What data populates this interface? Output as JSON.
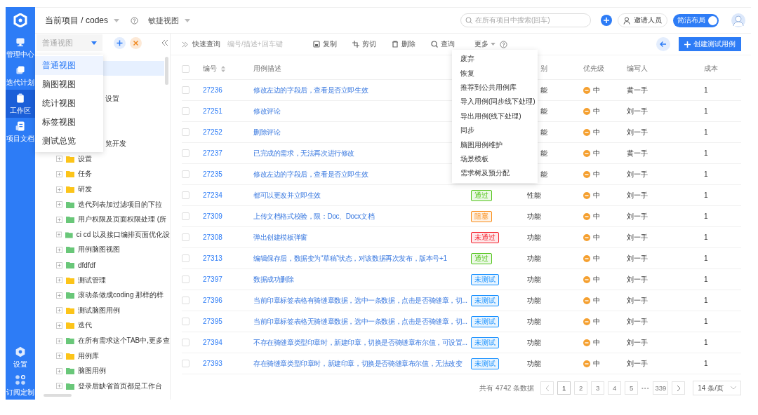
{
  "sidebar": {
    "items": [
      {
        "label": "管理中心",
        "selected": false
      },
      {
        "label": "迭代计划",
        "selected": false
      },
      {
        "label": "工作区",
        "selected": true
      },
      {
        "label": "项目文档",
        "selected": false
      }
    ],
    "bottom_items": [
      {
        "label": "设置"
      },
      {
        "label": "订阅定制"
      }
    ]
  },
  "topbar": {
    "project": "当前项目 / codes",
    "view": "敏捷视图",
    "search_placeholder": "在所有项目中搜索(回车)",
    "invite": "邀请人员",
    "layout_toggle": {
      "label": "简洁布局",
      "on": true
    }
  },
  "view_panel": {
    "select": {
      "value": "普通视图"
    },
    "options": [
      {
        "label": "普通视图",
        "selected": true
      },
      {
        "label": "脑图视图",
        "selected": false
      },
      {
        "label": "统计视图",
        "selected": false
      },
      {
        "label": "标签视图",
        "selected": false
      },
      {
        "label": "测试总览",
        "selected": false
      }
    ],
    "tree": [
      {
        "kind": "covered",
        "selected": true
      },
      {
        "kind": "covered",
        "selected": false
      },
      {
        "kind": "covered",
        "selected": false,
        "text": "设置"
      },
      {
        "kind": "covered",
        "selected": false
      },
      {
        "kind": "covered",
        "selected": false
      },
      {
        "kind": "covered",
        "selected": false,
        "text": "览开发"
      },
      {
        "kind": "folder",
        "text": "设置",
        "color": "#fcc419"
      },
      {
        "kind": "folder",
        "text": "任务",
        "color": "#fcc419"
      },
      {
        "kind": "folder",
        "text": "研发",
        "color": "#fcc419"
      },
      {
        "kind": "folder",
        "text": "迭代列表加过滤项目的下拉",
        "color": "#69c779"
      },
      {
        "kind": "folder",
        "text": "用户权限及页面权限处理 (所",
        "color": "#69c779"
      },
      {
        "kind": "folder",
        "text": "ci cd 以及接口编排页面优化设",
        "color": "#69c779"
      },
      {
        "kind": "folder",
        "text": " 用例脑图视图",
        "color": "#69c779"
      },
      {
        "kind": "folder",
        "text": "dfdfdf",
        "color": "#69c779"
      },
      {
        "kind": "folder",
        "text": "测试管理",
        "color": "#fcc419"
      },
      {
        "kind": "folder",
        "text": "滚动条做成coding 那样的样",
        "color": "#69c779"
      },
      {
        "kind": "folder",
        "text": "测试脑图用例",
        "color": "#fcc419"
      },
      {
        "kind": "folder",
        "text": "迭代",
        "color": "#fcc419"
      },
      {
        "kind": "folder",
        "text": "在所有需求这个TAB中,更多查",
        "color": "#69c779"
      },
      {
        "kind": "folder",
        "text": "用例库",
        "color": "#fcc419"
      },
      {
        "kind": "folder",
        "text": "脑图用例",
        "color": "#69c779"
      },
      {
        "kind": "folder",
        "text": "登录后缺省首页都是工作台",
        "color": "#69c779"
      }
    ]
  },
  "toolbar": {
    "quick_query": "快速查询",
    "query_placeholder": "编号/描述+回车键",
    "actions": [
      "复制",
      "剪切",
      "删除",
      "查询"
    ],
    "more": "更多",
    "create": "创建测试用例"
  },
  "more_menu": [
    "废弃",
    "恢复",
    "推荐到公共用例库",
    "导入用例(同步线下处理)",
    "导出用例(线下处理)",
    "同步",
    "脑图用例维护",
    "场景模板",
    "需求树及预分配"
  ],
  "table": {
    "all_checked": false,
    "columns": {
      "id": "编号",
      "description": "用例描述",
      "category": "别",
      "priority": "优先级",
      "author": "编写人",
      "cost": "成本"
    },
    "rows": [
      {
        "checked": false,
        "id": "27236",
        "description": "修改左边的字段后，查看是否立即生效",
        "covered": true,
        "category": "能",
        "priority": "中",
        "author": "黄一手",
        "cost": "1"
      },
      {
        "checked": false,
        "id": "27251",
        "description": "修改评论",
        "covered": true,
        "category": "能",
        "priority": "中",
        "author": "刘一手",
        "cost": "1"
      },
      {
        "checked": false,
        "id": "27252",
        "description": "删除评论",
        "covered": true,
        "category": "能",
        "priority": "中",
        "author": "刘一手",
        "cost": "1"
      },
      {
        "checked": false,
        "id": "27237",
        "description": "已完成的需求，无法再次进行修改",
        "covered": true,
        "category": "能",
        "priority": "中",
        "author": "黄一手",
        "cost": "1"
      },
      {
        "checked": false,
        "id": "27235",
        "description": "修改左边的字段后，查看是否立即生效",
        "covered": true,
        "category": "能",
        "priority": "中",
        "author": "刘一手",
        "cost": "1"
      },
      {
        "checked": false,
        "id": "27234",
        "description": "都可以更改并立即生效",
        "covered": false,
        "status": {
          "text": "通过",
          "color": "#52c41a"
        },
        "category": "性能",
        "priority": "中",
        "author": "刘一手",
        "cost": "1"
      },
      {
        "checked": false,
        "id": "27309",
        "description": "上传文档格式校验，限：Doc、Docx文档",
        "covered": false,
        "status": {
          "text": "阻塞",
          "color": "#fa8c16"
        },
        "category": "功能",
        "priority": "中",
        "author": "刘一手",
        "cost": "1"
      },
      {
        "checked": false,
        "id": "27308",
        "description": "弹出创建模板弹窗",
        "covered": false,
        "status": {
          "text": "未通过",
          "color": "#f5222d"
        },
        "category": "功能",
        "priority": "中",
        "author": "刘一手",
        "cost": "1"
      },
      {
        "checked": false,
        "id": "27313",
        "description": "编辑保存后，数据变为“草稿”状态，对该数据再次发布，版本号+1",
        "covered": false,
        "status": {
          "text": "通过",
          "color": "#52c41a"
        },
        "category": "功能",
        "priority": "中",
        "author": "刘一手",
        "cost": "1"
      },
      {
        "checked": false,
        "id": "27397",
        "description": "数据成功删除",
        "covered": false,
        "status": {
          "text": "未测试",
          "color": "#1890ff"
        },
        "category": "功能",
        "priority": "中",
        "author": "刘一手",
        "cost": "1"
      },
      {
        "checked": false,
        "id": "27396",
        "description": "当前印章标签表格有骑缝章数据，选中一条数据，点击是否骑缝章，切...",
        "covered": false,
        "status": {
          "text": "未测试",
          "color": "#1890ff"
        },
        "category": "功能",
        "priority": "中",
        "author": "刘一手",
        "cost": "1"
      },
      {
        "checked": false,
        "id": "27395",
        "description": "当前印章标签表格无骑缝章数据，选中一条数据，点击是否骑缝章，切...",
        "covered": false,
        "status": {
          "text": "未测试",
          "color": "#1890ff"
        },
        "category": "功能",
        "priority": "中",
        "author": "刘一手",
        "cost": "1"
      },
      {
        "checked": false,
        "id": "27394",
        "description": "不存在骑缝章类型印章时，新建印章，切换是否骑缝章布尔值，可设置...",
        "covered": false,
        "status": {
          "text": "未测试",
          "color": "#1890ff"
        },
        "category": "功能",
        "priority": "中",
        "author": "刘一手",
        "cost": "1"
      },
      {
        "checked": false,
        "id": "27393",
        "description": "存在骑缝章类型印章时，新建印章，切换是否骑缝章布尔值，无法改变",
        "covered": false,
        "status": {
          "text": "未测试",
          "color": "#1890ff"
        },
        "category": "功能",
        "priority": "中",
        "author": "刘一手",
        "cost": "1"
      }
    ]
  },
  "pagination": {
    "total": "共有 4742 条数据",
    "pages": [
      {
        "kind": "page",
        "label": "1",
        "selected": true
      },
      {
        "kind": "page",
        "label": "2",
        "selected": false
      },
      {
        "kind": "page",
        "label": "3",
        "selected": false
      },
      {
        "kind": "page",
        "label": "4",
        "selected": false
      },
      {
        "kind": "page",
        "label": "5",
        "selected": false
      },
      {
        "kind": "ellipsis",
        "label": "•••"
      },
      {
        "kind": "page",
        "label": "339",
        "selected": false
      }
    ],
    "page_size": "14 条/页"
  }
}
